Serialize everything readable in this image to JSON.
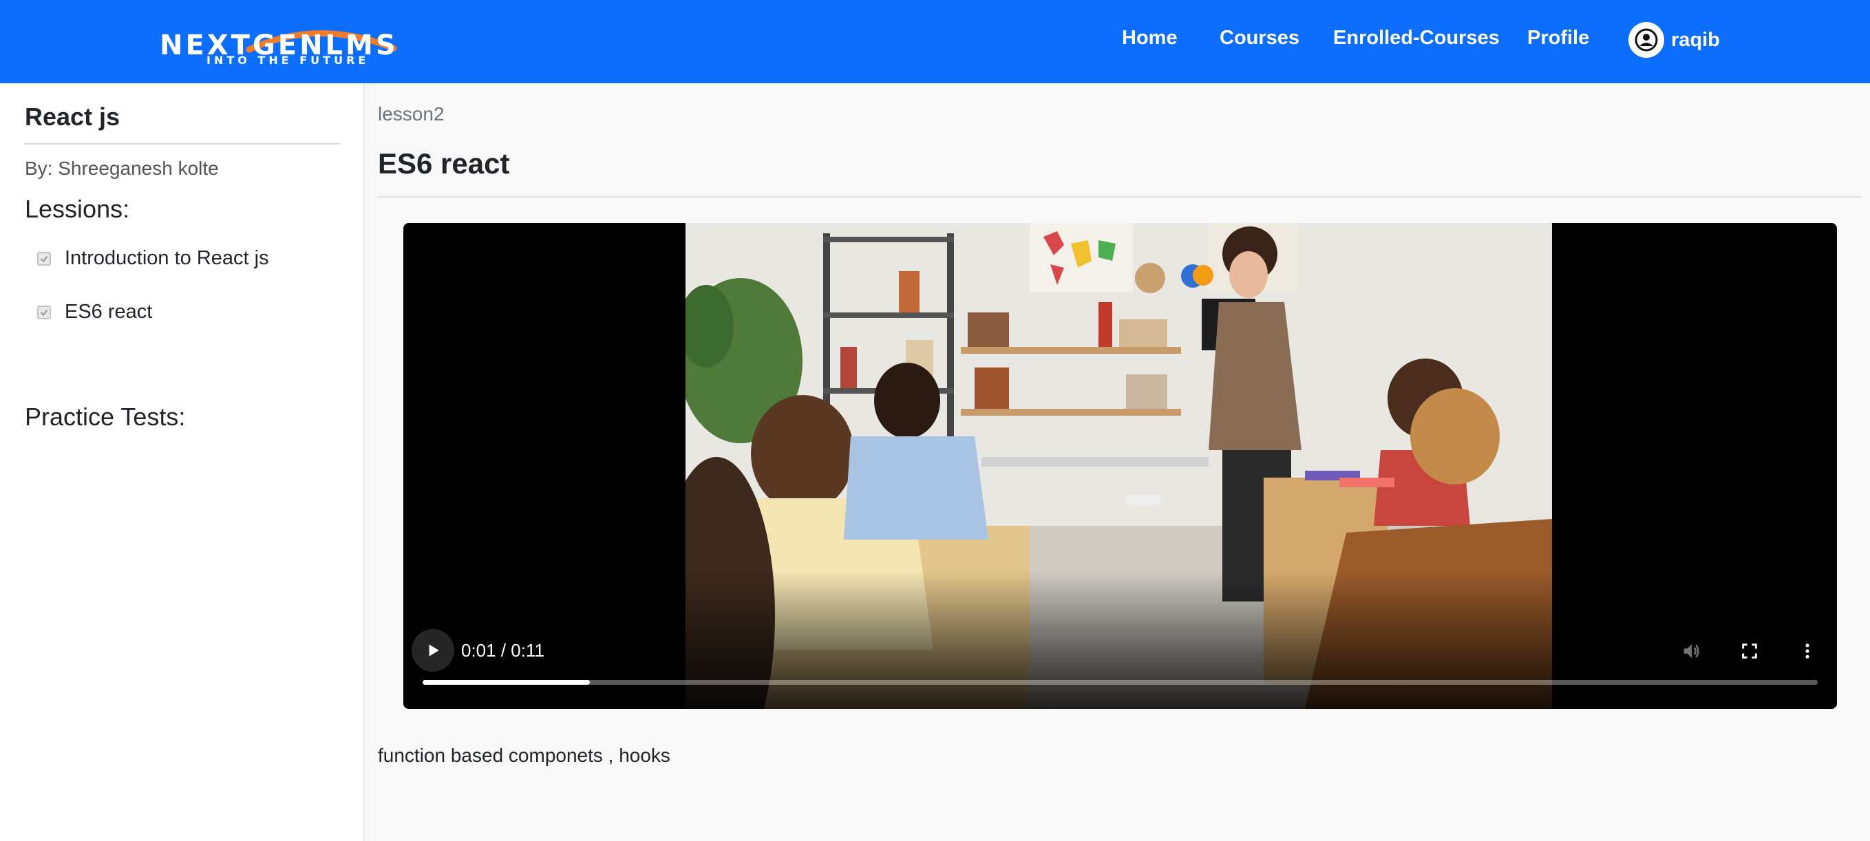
{
  "navbar": {
    "brand": {
      "name": "NEXTGENLMS",
      "tagline": "INTO THE FUTURE"
    },
    "links": [
      "Home",
      "Courses",
      "Enrolled-Courses",
      "Profile"
    ],
    "user": {
      "name": "raqib",
      "icon": "user-circle-icon"
    },
    "colors": {
      "background": "#0d6efd",
      "brand_arc": "#f07c2a"
    }
  },
  "sidebar": {
    "course_title": "React js",
    "author": "By: Shreeganesh kolte",
    "lessons_heading": "Lessions:",
    "lessons": [
      {
        "label": "Introduction to React js",
        "checked": true
      },
      {
        "label": "ES6 react",
        "checked": true
      }
    ],
    "tests_heading": "Practice Tests:"
  },
  "main": {
    "breadcrumb": "lesson2",
    "title": "ES6 react",
    "video": {
      "time": "0:01 / 0:11",
      "progress": 0.12,
      "thumbnail": "classroom-scene",
      "icons": [
        "play-icon",
        "volume-icon",
        "fullscreen-icon",
        "more-vertical-icon"
      ]
    },
    "description": "function based componets , hooks"
  }
}
